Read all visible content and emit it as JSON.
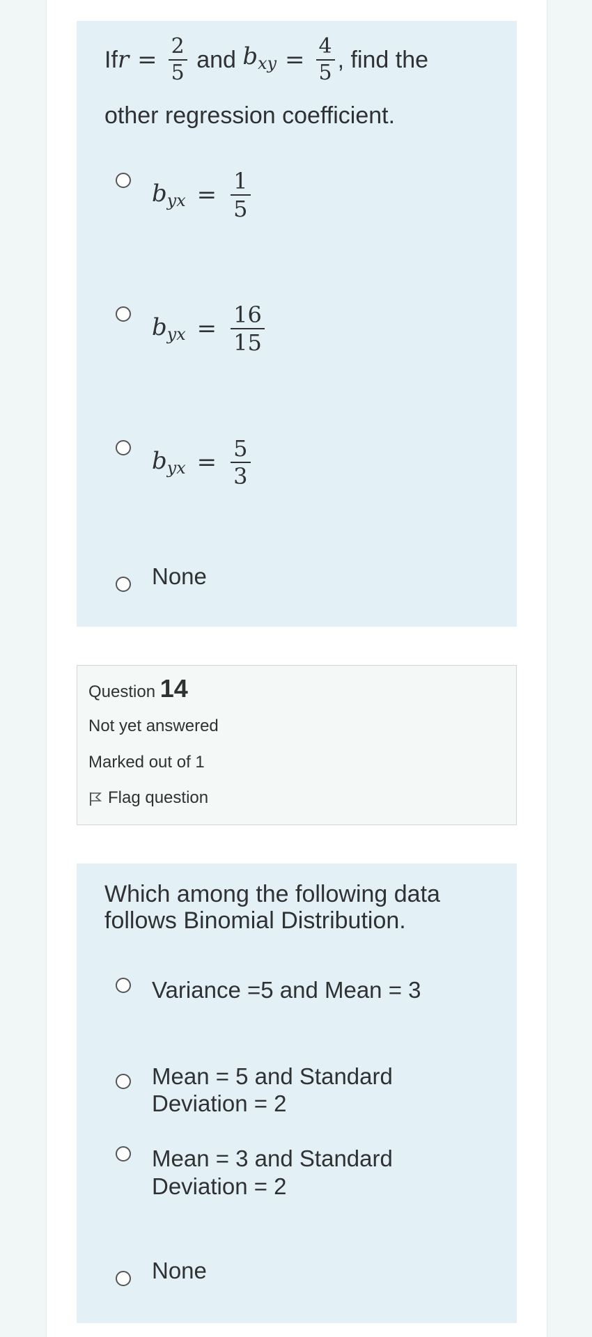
{
  "q13": {
    "prefix": "If ",
    "r_var": "r",
    "eq": "=",
    "r_num": "2",
    "r_den": "5",
    "and": " and ",
    "bxy_base": "b",
    "bxy_sub": "xy",
    "bxy_num": "4",
    "bxy_den": "5",
    "suffix": ", find the",
    "line2": "other regression coefficient.",
    "options": [
      {
        "base": "b",
        "sub": "yx",
        "eq": "=",
        "num": "1",
        "den": "5"
      },
      {
        "base": "b",
        "sub": "yx",
        "eq": "=",
        "num": "16",
        "den": "15"
      },
      {
        "base": "b",
        "sub": "yx",
        "eq": "=",
        "num": "5",
        "den": "3"
      },
      {
        "text": "None"
      }
    ]
  },
  "q14info": {
    "question_label": "Question ",
    "question_number": "14",
    "state": "Not yet answered",
    "marks": "Marked out of 1",
    "flag_label": "Flag question"
  },
  "q14": {
    "text_line1": "Which among the following data",
    "text_line2": "follows Binomial Distribution.",
    "options": [
      {
        "line1": "Variance =5 and Mean = 3",
        "line2": ""
      },
      {
        "line1": "Mean = 5 and Standard",
        "line2": "Deviation = 2"
      },
      {
        "line1": "Mean = 3 and Standard",
        "line2": "Deviation = 2"
      },
      {
        "line1": "None",
        "line2": ""
      }
    ]
  }
}
